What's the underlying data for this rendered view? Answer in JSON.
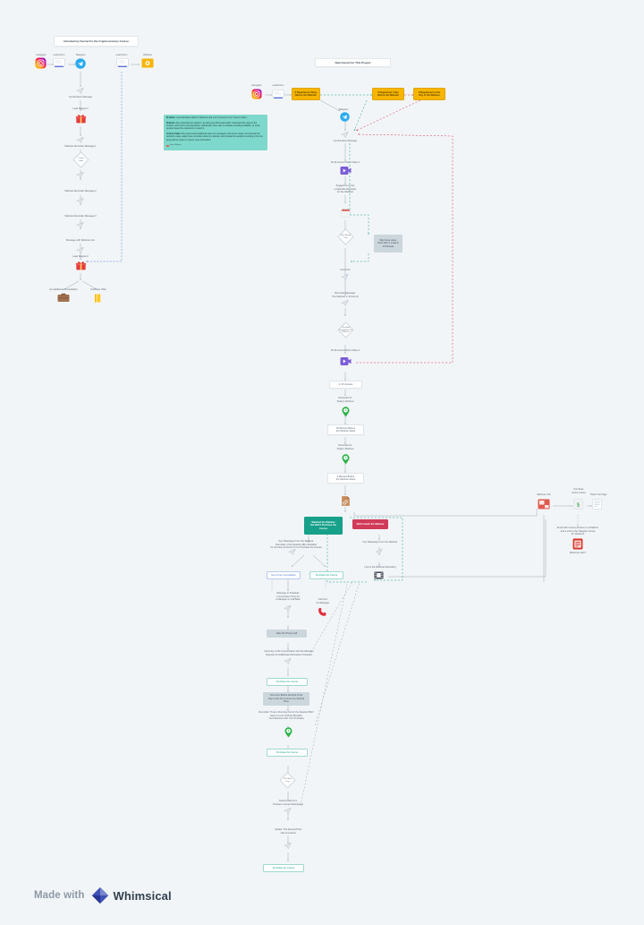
{
  "board": {
    "background": "#f2f5f7",
    "accent_orange": "#f7b500",
    "accent_green": "#17a08a",
    "accent_red": "#d13a58",
    "accent_blue": "#4a78d6"
  },
  "footer": {
    "made_with": "Made with",
    "brand": "Whimsical",
    "logo_icon": "whimsical-diamond-icon"
  },
  "old_funnel": {
    "title": "Introductory Funnel for the Cryptocurrency Course",
    "sources": [
      {
        "label": "Instagram",
        "icon": "instagram-icon"
      },
      {
        "label": "Lead Form",
        "icon": "lead-form-icon"
      },
      {
        "label": "Telegram",
        "icon": "telegram-icon"
      },
      {
        "label": "Lead Form",
        "icon": "lead-form-icon"
      },
      {
        "label": "Webinar",
        "icon": "webinar-icon"
      }
    ],
    "steps": [
      {
        "label": "Confirmation Message",
        "icon": "paper-plane-icon"
      },
      {
        "label": "Lead Magnet 1",
        "icon": "gift-icon"
      },
      {
        "label": "Webinar Reminder Message 1",
        "icon": "paper-plane-icon"
      },
      {
        "label": "2 Days\nLater",
        "icon": "decision-diamond-icon"
      },
      {
        "label": "Webinar Reminder Message 2",
        "icon": "paper-plane-icon"
      },
      {
        "label": "Webinar Reminder Message 3",
        "icon": "paper-plane-icon"
      },
      {
        "label": "Message with Webinar Link",
        "icon": "paper-plane-icon"
      },
      {
        "label": "Lead Magnet 2",
        "icon": "gift-icon"
      }
    ],
    "outcomes": [
      {
        "label": "Get Additional Consultation",
        "icon": "briefcase-icon"
      },
      {
        "label": "Purchase Offer",
        "icon": "books-icon"
      }
    ]
  },
  "note": {
    "problem_label": "Problem:",
    "problem_text": " Low Attendance Rate for Webinars and Low Conversion from Views to Sales.",
    "solution_label": "Solution:",
    "solution_text": " After analyzing the situation, we discovered that leads didn't understand the value of the webinar, which led to low attendance. Additionally, there was no webinar recording available, so many people missed the opportunity to watch it.",
    "actions_label": "Actions Taken:",
    "actions_text": " We implemented additional warm-up messages in the bot to clearly communicate the webinar's value, added more reminders about the webinar, and included the webinar recording in the bot, along with an option to receive more information.",
    "meta": "Irina Volkova",
    "meta_icon": "avatar-dot-icon"
  },
  "new_funnel": {
    "title": "New Funnel for This Project",
    "sources": [
      {
        "label": "Instagram",
        "icon": "instagram-icon"
      },
      {
        "label": "Lead Form",
        "icon": "lead-form-icon"
      },
      {
        "label": "Telegram",
        "icon": "telegram-icon"
      }
    ],
    "conditions": [
      "If Registered 2 Days\nBefore the Webinar",
      "If Registered 1 Day\nBefore the Webinar",
      "If Registered on the\nDay of the Webinar"
    ],
    "steps": [
      {
        "label": "Confirmation Message",
        "icon": "paper-plane-icon"
      },
      {
        "label": "15-30 second Short Video 1",
        "icon": "video-icon"
      },
      {
        "label": "Suggestion to Set\na Calendar Reminder\nfor the Webinar",
        "icon": "calendar-icon"
      },
      {
        "label": "Two Weeks\nDay",
        "icon": "decision-diamond-icon"
      },
      {
        "label": "Feed Out",
        "icon": "paper-plane-icon"
      },
      {
        "label": "Reminder Message:\nThe Webinar is Tomorrow",
        "icon": "paper-plane-icon"
      },
      {
        "label": "The Next\nDay Before the Webinar",
        "icon": "decision-diamond-icon"
      },
      {
        "label": "15-30 second Short Video 2",
        "icon": "video-icon"
      },
      {
        "label": "In 15 minutes",
        "icon": "box-icon"
      },
      {
        "label": "Reminder for\nToday's Webinar",
        "icon": "clock-pin-icon"
      },
      {
        "label": "30 Minutes Before\nthe Webinar Starts",
        "icon": "box-icon"
      },
      {
        "label": "Reminder for\nToday's Webinar",
        "icon": "clock-pin-icon"
      },
      {
        "label": "5 Minutes Before\nthe Webinar Starts",
        "icon": "box-icon"
      },
      {
        "label": "",
        "icon": "link-icon"
      }
    ],
    "skip_note": "Skip these steps.\nSend after 5 email in\n15 Minutes",
    "branches": {
      "watched": "Watched the Webinar\nbut Didn't Purchase the\nCourse",
      "not_watched": "Didn't watch the Webinar"
    },
    "watched_path": {
      "message": "Key Takeaways from the Webinar\nReminder of the Special Offer Available\nfor the Next 24 Hours if You Purchase the Course",
      "icon": "paper-plane-icon",
      "options": [
        {
          "label": "Get a Free Consultation",
          "style": "blue"
        },
        {
          "label": "Purchase the Course",
          "style": "green"
        }
      ],
      "schedule_msg": "Message to Schedule\na Convenient Time for\na Manager to Call Back",
      "schedule_icon": "paper-plane-icon",
      "call_label": "Call from\nthe Manager",
      "call_icon": "phone-icon",
      "after_call": "After the Phone Call",
      "summary": "Summary of the Conversation with the Manager\nRequest for Additional Information if Needed",
      "summary_icon": "paper-plane-icon",
      "purchase_1": "Purchase the Course",
      "special_price": "One Hour Before the End of the\nDay to Get the Course at a Special\nPrice",
      "reminder": "Reminder: Time is Running Out for the Special Offer!\nHere's a List of All the Benefits\nYou'll Receive with Your Purchase",
      "reminder_icon": "clock-pin-icon",
      "purchase_2": "Purchase the Course",
      "next_day": "The Next\nDay",
      "testimonials": "Testimonials from\nPrevious Course Participants",
      "testimonials_icon": "paper-plane-icon",
      "update_price": "Update: The Special Price\nHas Increased",
      "update_icon": "paper-plane-icon",
      "purchase_3": "Purchase the Course"
    },
    "not_watched_path": {
      "message": "Key Takeaways from the Webinar",
      "icon": "paper-plane-icon",
      "recording_label": "Link to the Webinar Recording",
      "recording_icon": "film-icon"
    },
    "purchase_flow": [
      {
        "label": "Webinar   Link",
        "icon": "webinar-link-icon"
      },
      {
        "label": "Purchase\nonline course",
        "icon": "money-icon"
      },
      {
        "label": "Thank You Page",
        "icon": "page-icon"
      }
    ],
    "course_access": {
      "label": "Email with Course Access on a Platform\nand a Link to the Telegram Group\nfor Students",
      "icon": "email-icon",
      "sub_label": "Welcome LECT"
    }
  }
}
